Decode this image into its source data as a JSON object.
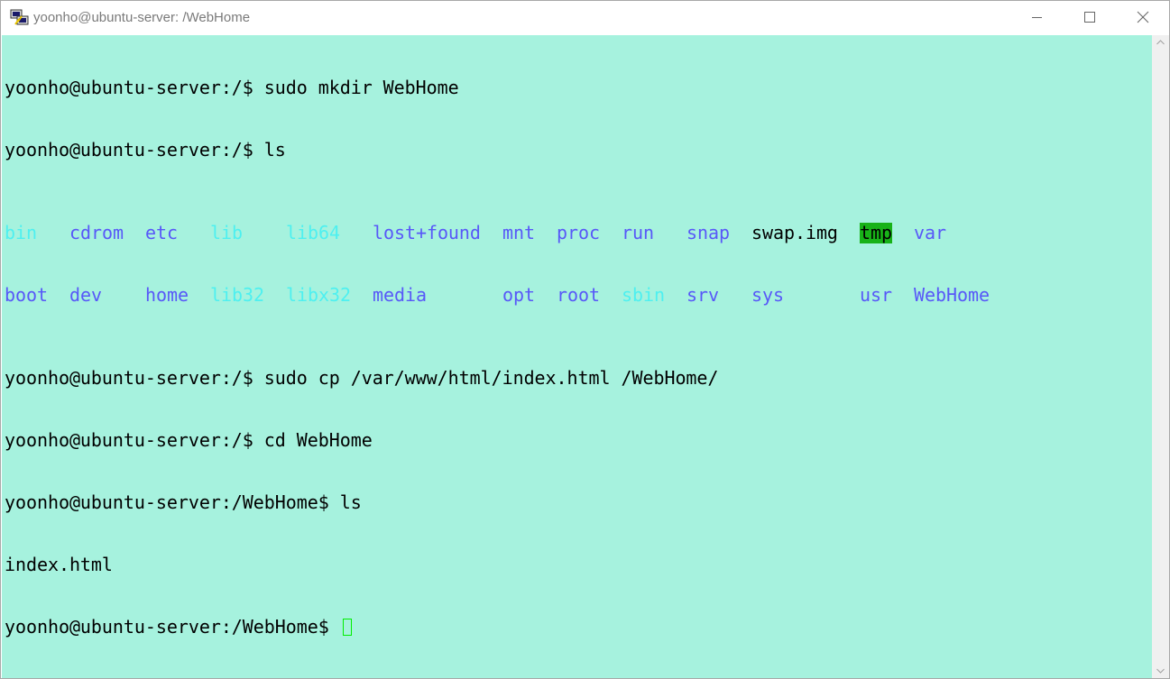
{
  "window": {
    "title": "yoonho@ubuntu-server: /WebHome",
    "app_icon": "putty-icon",
    "buttons": {
      "minimize_icon": "minimize-icon",
      "maximize_icon": "maximize-icon",
      "close_icon": "close-icon"
    }
  },
  "terminal": {
    "background": "#a6f2de",
    "lines": [
      "yoonho@ubuntu-server:/$ sudo mkdir WebHome",
      "yoonho@ubuntu-server:/$ ls"
    ],
    "ls_output": {
      "row1": [
        "bin",
        "cdrom",
        "etc",
        "lib",
        "lib64",
        "lost+found",
        "mnt",
        "proc",
        "run",
        "snap",
        "swap.img",
        "tmp",
        "var"
      ],
      "row2": [
        "boot",
        "dev",
        "home",
        "lib32",
        "libx32",
        "media",
        "opt",
        "root",
        "sbin",
        "srv",
        "sys",
        "usr",
        "WebHome"
      ]
    },
    "lines_after": [
      "yoonho@ubuntu-server:/$ sudo cp /var/www/html/index.html /WebHome/",
      "yoonho@ubuntu-server:/$ cd WebHome",
      "yoonho@ubuntu-server:/WebHome$ ls",
      "index.html"
    ],
    "prompt": "yoonho@ubuntu-server:/WebHome$ ",
    "colors": {
      "link_cyan": "#4ef0f0",
      "dir_blue": "#5858f8",
      "sticky_green": "#18b218",
      "cursor_green": "#00ee00"
    }
  }
}
